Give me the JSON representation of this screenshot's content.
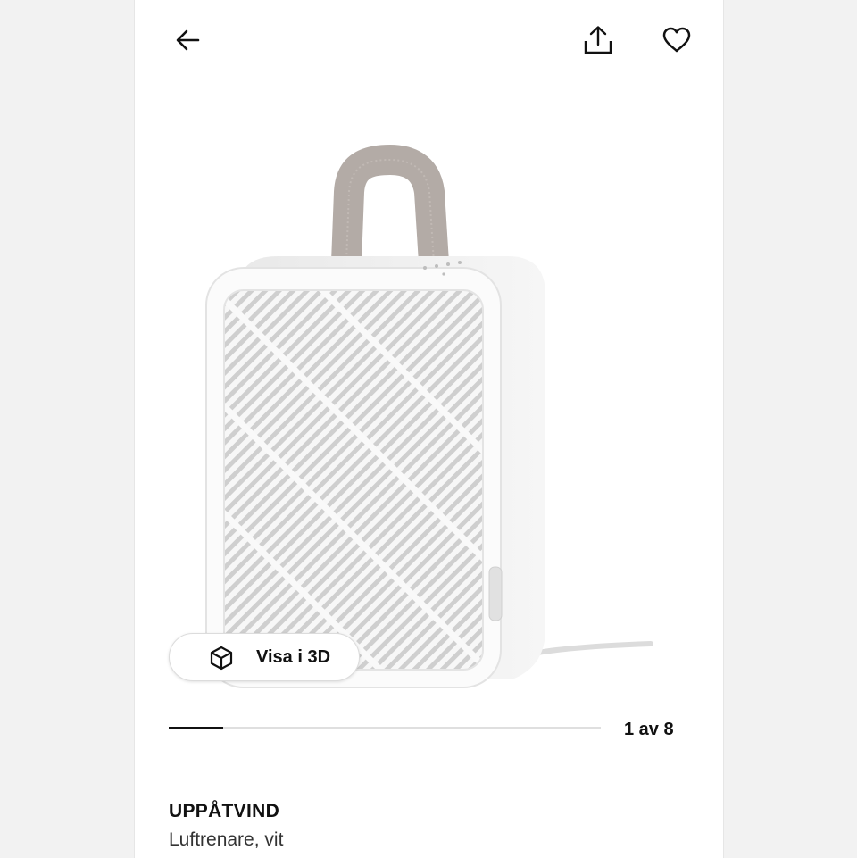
{
  "icons": {
    "back": "arrow-left-icon",
    "share": "share-icon",
    "favorite": "heart-icon",
    "view3d": "cube-3d-icon"
  },
  "gallery": {
    "view3d_label": "Visa i 3D",
    "counter": "1 av 8",
    "current": 1,
    "total": 8
  },
  "product": {
    "name": "UPPÅTVIND",
    "description": "Luftrenare, vit"
  },
  "colors": {
    "background": "#ffffff",
    "text": "#111111",
    "progress_track": "#dfdfdf",
    "progress_fill": "#111111",
    "strap": "#b3aba6"
  }
}
